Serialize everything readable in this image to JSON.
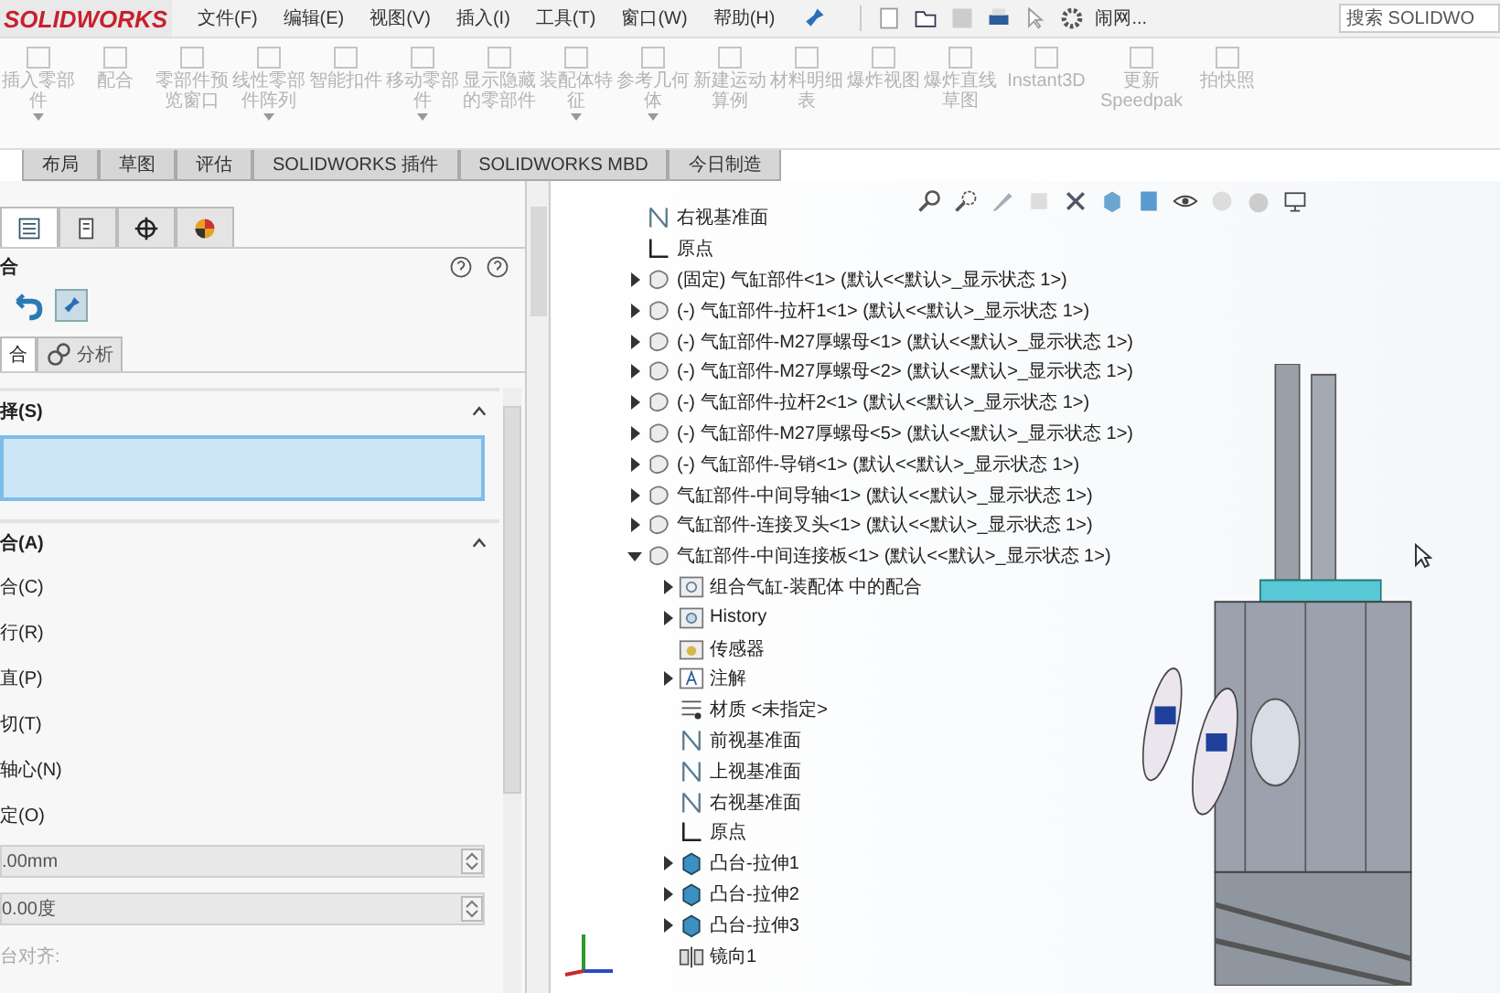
{
  "app": {
    "logo": "SOLIDWORKS",
    "menu": [
      "文件(F)",
      "编辑(E)",
      "视图(V)",
      "插入(I)",
      "工具(T)",
      "窗口(W)",
      "帮助(H)"
    ],
    "user": "闹网...",
    "search": {
      "placeholder": "搜索 SOLIDWO"
    }
  },
  "ribbon": [
    {
      "label": "插入零部件",
      "caret": true
    },
    {
      "label": "配合",
      "caret": false
    },
    {
      "label": "零部件预览窗口",
      "caret": false
    },
    {
      "label": "线性零部件阵列",
      "caret": true
    },
    {
      "label": "智能扣件",
      "caret": false
    },
    {
      "label": "移动零部件",
      "caret": true
    },
    {
      "label": "显示隐藏的零部件",
      "caret": false
    },
    {
      "label": "装配体特征",
      "caret": true
    },
    {
      "label": "参考几何体",
      "caret": true
    },
    {
      "label": "新建运动算例",
      "caret": false
    },
    {
      "label": "材料明细表",
      "caret": false
    },
    {
      "label": "爆炸视图",
      "caret": false
    },
    {
      "label": "爆炸直线草图",
      "caret": false
    },
    {
      "label": "Instant3D",
      "caret": false
    },
    {
      "label": "更新 Speedpak",
      "caret": false
    },
    {
      "label": "拍快照",
      "caret": false
    }
  ],
  "tabs": [
    {
      "label": "布局",
      "selected": false
    },
    {
      "label": "草图",
      "selected": false
    },
    {
      "label": "评估",
      "selected": false
    },
    {
      "label": "SOLIDWORKS 插件",
      "selected": false
    },
    {
      "label": "SOLIDWORKS MBD",
      "selected": false
    },
    {
      "label": "今日制造",
      "selected": false
    }
  ],
  "panel": {
    "tabs": [
      {
        "kind": "tree",
        "selected": true
      },
      {
        "kind": "property",
        "selected": false
      },
      {
        "kind": "config",
        "selected": false
      },
      {
        "kind": "display",
        "selected": false
      }
    ],
    "title": "合",
    "pinned": true,
    "subtabs": [
      {
        "label": "合",
        "selected": true
      },
      {
        "label": "分析",
        "selected": false
      }
    ],
    "selection": {
      "title": "择(S)"
    },
    "mates": {
      "title": "合(A)",
      "options": [
        "合(C)",
        "行(R)",
        "直(P)",
        "切(T)",
        "轴心(N)",
        "定(O)"
      ],
      "distance": ".00mm",
      "angle": "0.00度",
      "alignment": "台对齐:"
    }
  },
  "tree": [
    {
      "kind": "plane",
      "label": "右视基准面"
    },
    {
      "kind": "origin",
      "label": "原点"
    },
    {
      "kind": "part",
      "label": "(固定) 气缸部件<1> (默认<<默认>_显示状态 1>)",
      "expanded": false
    },
    {
      "kind": "part",
      "label": "(-) 气缸部件-拉杆1<1> (默认<<默认>_显示状态 1>)",
      "expanded": false
    },
    {
      "kind": "part",
      "label": "(-) 气缸部件-M27厚螺母<1> (默认<<默认>_显示状态 1>)",
      "expanded": false
    },
    {
      "kind": "part",
      "label": "(-) 气缸部件-M27厚螺母<2> (默认<<默认>_显示状态 1>)",
      "expanded": false
    },
    {
      "kind": "part",
      "label": "(-) 气缸部件-拉杆2<1> (默认<<默认>_显示状态 1>)",
      "expanded": false
    },
    {
      "kind": "part",
      "label": "(-) 气缸部件-M27厚螺母<5> (默认<<默认>_显示状态 1>)",
      "expanded": false
    },
    {
      "kind": "part",
      "label": "(-) 气缸部件-导销<1> (默认<<默认>_显示状态 1>)",
      "expanded": false
    },
    {
      "kind": "part",
      "label": "气缸部件-中间导轴<1> (默认<<默认>_显示状态 1>)",
      "expanded": false
    },
    {
      "kind": "part",
      "label": "气缸部件-连接叉头<1> (默认<<默认>_显示状态 1>)",
      "expanded": false
    },
    {
      "kind": "part",
      "label": "气缸部件-中间连接板<1> (默认<<默认>_显示状态 1>)",
      "expanded": true,
      "children": [
        {
          "kind": "mates",
          "label": "组合气缸-装配体 中的配合",
          "expanded": false
        },
        {
          "kind": "history",
          "label": "History",
          "expanded": false
        },
        {
          "kind": "sensor",
          "label": "传感器"
        },
        {
          "kind": "annotation",
          "label": "注解",
          "expanded": false
        },
        {
          "kind": "material",
          "label": "材质 <未指定>"
        },
        {
          "kind": "plane",
          "label": "前视基准面"
        },
        {
          "kind": "plane",
          "label": "上视基准面"
        },
        {
          "kind": "plane",
          "label": "右视基准面"
        },
        {
          "kind": "origin",
          "label": "原点"
        },
        {
          "kind": "extrude",
          "label": "凸台-拉伸1",
          "expanded": false
        },
        {
          "kind": "extrude",
          "label": "凸台-拉伸2",
          "expanded": false
        },
        {
          "kind": "extrude",
          "label": "凸台-拉伸3",
          "expanded": false
        },
        {
          "kind": "mirror",
          "label": "镜向1"
        }
      ]
    }
  ]
}
